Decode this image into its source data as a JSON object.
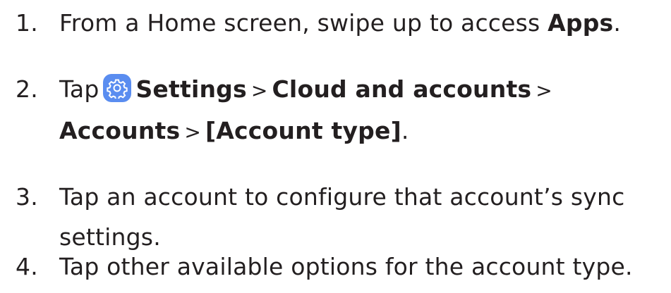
{
  "steps": [
    {
      "number": "1.",
      "text_before": "From a Home screen, swipe up to access ",
      "bold_apps": "Apps",
      "text_after": "."
    },
    {
      "number": "2.",
      "tap": "Tap",
      "icon": "settings-gear-icon",
      "settings": "Settings",
      "sep": ">",
      "cloud": "Cloud and accounts",
      "accounts": "Accounts",
      "account_type": "[Account type]",
      "end": "."
    },
    {
      "number": "3.",
      "line1": "Tap an account to configure that account’s sync",
      "line2": "settings."
    },
    {
      "number": "4.",
      "text": "Tap other available options for the account type."
    }
  ],
  "colors": {
    "text": "#231f20",
    "icon_bg": "#5a8df0"
  }
}
